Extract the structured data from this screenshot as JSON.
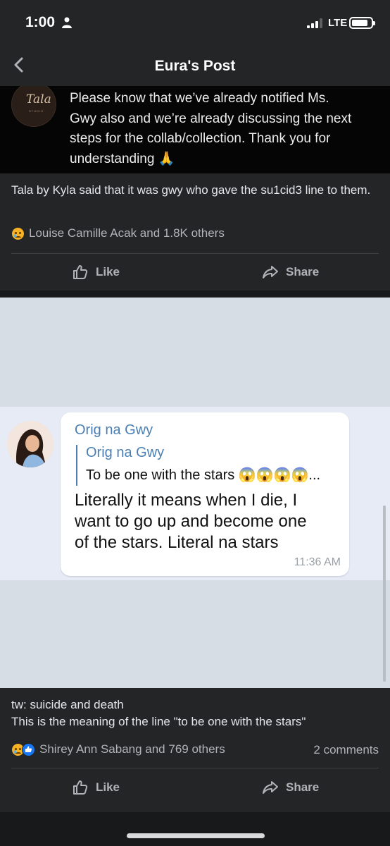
{
  "status_bar": {
    "time": "1:00",
    "network": "LTE",
    "battery_level": 0.85
  },
  "nav": {
    "title": "Eura's Post",
    "back_icon": "chevron-left-icon"
  },
  "posts": [
    {
      "image": {
        "logo_text": "Tala",
        "logo_subtext": "STUDIO",
        "message_lines": [
          "Please know that we’ve already notified Ms.",
          "Gwy also and we’re already discussing the next",
          "steps for the collab/collection. Thank you for",
          "understanding 🙏"
        ]
      },
      "caption": "Tala by Kyla said that it was gwy who gave the su1cid3 line to them.",
      "reactions_text": "Louise Camille Acak and 1.8K others",
      "reaction_icons": [
        "sad-reaction-icon"
      ],
      "comments": "",
      "like_label": "Like",
      "share_label": "Share"
    },
    {
      "image": {
        "sender": "Orig na Gwy",
        "quoted_sender": "Orig na Gwy",
        "quoted_text": "To be one with the stars 😱😱😱😱...",
        "message_lines": [
          "Literally it means when I die, I",
          "want to go up and become one",
          "of the stars. Literal na stars"
        ],
        "time": "11:36 AM"
      },
      "caption_line1": "tw: suicide and death",
      "caption_line2": "This is the meaning of the line \"to be one with the stars\"",
      "reactions_text": "Shirey Ann Sabang and 769 others",
      "reaction_icons": [
        "sad-reaction-icon",
        "like-reaction-icon"
      ],
      "comments": "2 comments",
      "like_label": "Like",
      "share_label": "Share"
    }
  ],
  "colors": {
    "background": "#18191a",
    "card": "#242526",
    "text_primary": "#e4e6eb",
    "text_secondary": "#b0b3b8",
    "chat_accent": "#4a7fb5",
    "like_blue": "#1877f2"
  }
}
